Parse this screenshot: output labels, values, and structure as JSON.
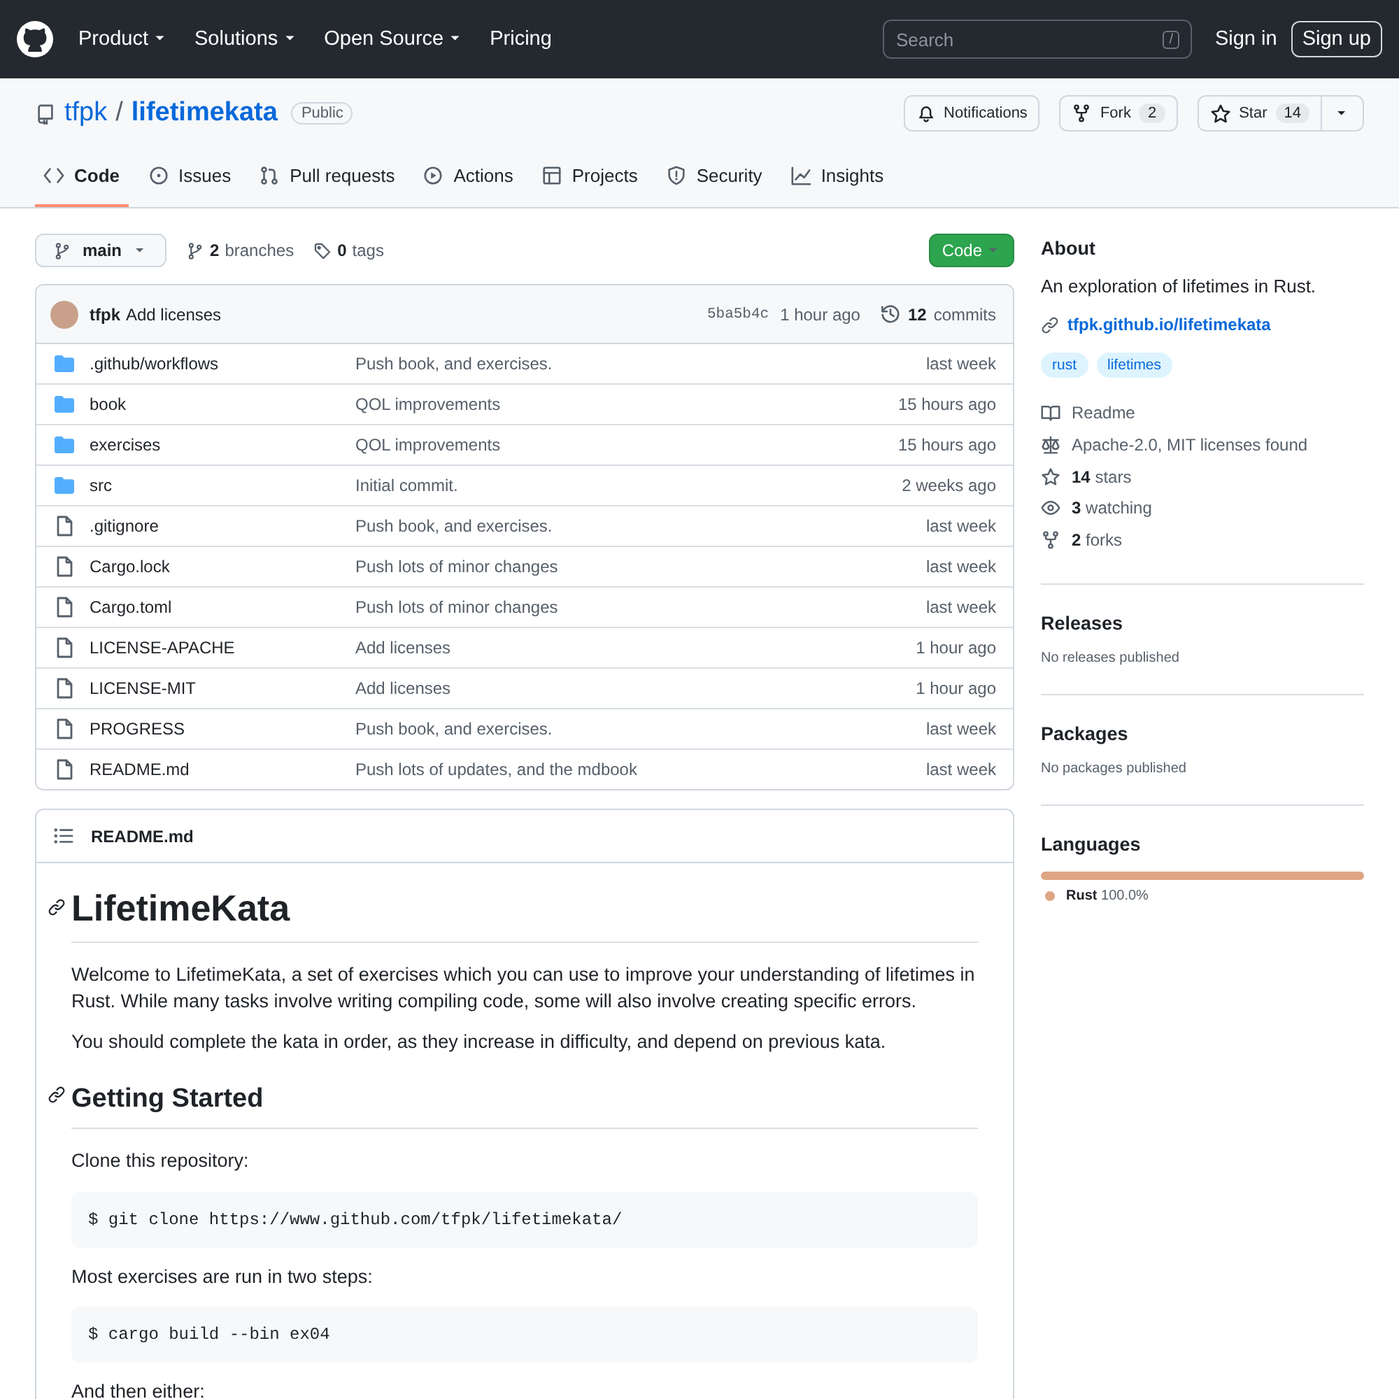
{
  "header": {
    "nav": [
      {
        "label": "Product",
        "dropdown": true
      },
      {
        "label": "Solutions",
        "dropdown": true
      },
      {
        "label": "Open Source",
        "dropdown": true
      },
      {
        "label": "Pricing",
        "dropdown": false
      }
    ],
    "search": {
      "placeholder": "Search",
      "key": "/"
    },
    "sign_in": "Sign in",
    "sign_up": "Sign up"
  },
  "repo": {
    "owner": "tfpk",
    "separator": "/",
    "name": "lifetimekata",
    "visibility": "Public",
    "notifications": "Notifications",
    "fork": {
      "label": "Fork",
      "count": "2"
    },
    "star": {
      "label": "Star",
      "count": "14"
    }
  },
  "tabs": [
    {
      "label": "Code",
      "kind": "code",
      "selected": true
    },
    {
      "label": "Issues",
      "kind": "issue",
      "selected": false
    },
    {
      "label": "Pull requests",
      "kind": "pull",
      "selected": false
    },
    {
      "label": "Actions",
      "kind": "play",
      "selected": false
    },
    {
      "label": "Projects",
      "kind": "table",
      "selected": false
    },
    {
      "label": "Security",
      "kind": "shield",
      "selected": false
    },
    {
      "label": "Insights",
      "kind": "graph",
      "selected": false
    }
  ],
  "toolbar": {
    "branch": "main",
    "branches": {
      "count": "2",
      "label": "branches"
    },
    "tags": {
      "count": "0",
      "label": "tags"
    },
    "code_button": "Code"
  },
  "commit": {
    "author": "tfpk",
    "message": "Add licenses",
    "sha": "5ba5b4c",
    "time": "1 hour ago",
    "commits": {
      "count": "12",
      "label": "commits"
    }
  },
  "files": [
    {
      "kind": "dir",
      "name": ".github/workflows",
      "message": "Push book, and exercises.",
      "time": "last week"
    },
    {
      "kind": "dir",
      "name": "book",
      "message": "QOL improvements",
      "time": "15 hours ago"
    },
    {
      "kind": "dir",
      "name": "exercises",
      "message": "QOL improvements",
      "time": "15 hours ago"
    },
    {
      "kind": "dir",
      "name": "src",
      "message": "Initial commit.",
      "time": "2 weeks ago"
    },
    {
      "kind": "file",
      "name": ".gitignore",
      "message": "Push book, and exercises.",
      "time": "last week"
    },
    {
      "kind": "file",
      "name": "Cargo.lock",
      "message": "Push lots of minor changes",
      "time": "last week"
    },
    {
      "kind": "file",
      "name": "Cargo.toml",
      "message": "Push lots of minor changes",
      "time": "last week"
    },
    {
      "kind": "file",
      "name": "LICENSE-APACHE",
      "message": "Add licenses",
      "time": "1 hour ago"
    },
    {
      "kind": "file",
      "name": "LICENSE-MIT",
      "message": "Add licenses",
      "time": "1 hour ago"
    },
    {
      "kind": "file",
      "name": "PROGRESS",
      "message": "Push book, and exercises.",
      "time": "last week"
    },
    {
      "kind": "file",
      "name": "README.md",
      "message": "Push lots of updates, and the mdbook",
      "time": "last week"
    }
  ],
  "readme": {
    "title": "README.md",
    "blocks": [
      {
        "kind": "h1",
        "text": "LifetimeKata"
      },
      {
        "kind": "p",
        "text": "Welcome to LifetimeKata, a set of exercises which you can use to improve your understanding of lifetimes in Rust. While many tasks involve writing compiling code, some will also involve creating specific errors."
      },
      {
        "kind": "p",
        "text": "You should complete the kata in order, as they increase in difficulty, and depend on previous kata."
      },
      {
        "kind": "h2",
        "text": "Getting Started"
      },
      {
        "kind": "p",
        "text": "Clone this repository:"
      },
      {
        "kind": "code",
        "text": "$ git clone https://www.github.com/tfpk/lifetimekata/"
      },
      {
        "kind": "p",
        "text": "Most exercises are run in two steps:"
      },
      {
        "kind": "code",
        "text": "$ cargo build --bin ex04"
      },
      {
        "kind": "p",
        "text": "And then either:"
      }
    ]
  },
  "about": {
    "heading": "About",
    "description": "An exploration of lifetimes in Rust.",
    "link": "tfpk.github.io/lifetimekata",
    "topics": [
      "rust",
      "lifetimes"
    ],
    "stats": [
      {
        "kind": "book",
        "label": "Readme"
      },
      {
        "kind": "scale",
        "label": "Apache-2.0, MIT licenses found"
      },
      {
        "kind": "star",
        "count": "14",
        "label": "stars"
      },
      {
        "kind": "eye",
        "count": "3",
        "label": "watching"
      },
      {
        "kind": "fork",
        "count": "2",
        "label": "forks"
      }
    ],
    "releases": {
      "heading": "Releases",
      "note": "No releases published"
    },
    "packages": {
      "heading": "Packages",
      "note": "No packages published"
    },
    "languages": {
      "heading": "Languages",
      "items": [
        {
          "name": "Rust",
          "percent": "100.0%",
          "color": "#dea584",
          "level": 1
        }
      ]
    }
  }
}
